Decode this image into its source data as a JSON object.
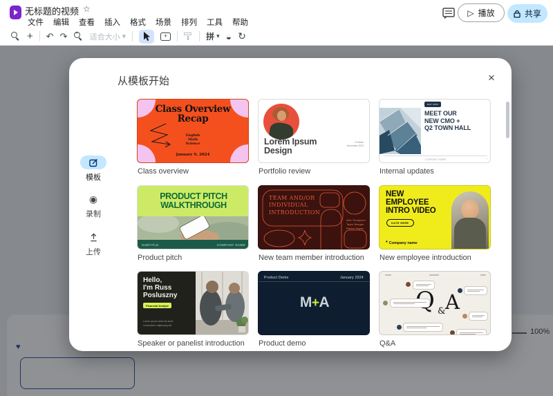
{
  "header": {
    "title": "无标题的视频",
    "menu": [
      "文件",
      "编辑",
      "查看",
      "插入",
      "格式",
      "场景",
      "排列",
      "工具",
      "帮助"
    ],
    "play": "播放",
    "share": "共享"
  },
  "toolbar": {
    "fit": "适合大小",
    "pin": "拼"
  },
  "icons": {
    "star": "☆",
    "caret": "▾",
    "undo": "↶",
    "redo": "↷",
    "plus": "+",
    "play_outline": "▷",
    "record": "◉",
    "theme": "◒",
    "transition": "↻",
    "close": "×",
    "heart": "♥",
    "asterisk": "*",
    "chevron_right": "›"
  },
  "modal": {
    "title": "从模板开始",
    "sidebar": [
      {
        "label": "模板",
        "active": true
      },
      {
        "label": "录制",
        "active": false
      },
      {
        "label": "上传",
        "active": false
      }
    ],
    "templates": [
      {
        "caption": "Class overview",
        "title": "Class Overview\nRecap",
        "subjects": "English\nMath\nScience",
        "date": "January 9, 2024"
      },
      {
        "caption": "Portfolio review",
        "title": "Lorem Ipsum\nDesign",
        "meta": "Portfolio\nNovember 2023"
      },
      {
        "caption": "Internal updates",
        "badge": "MAY 2023",
        "title": "MEET OUR\nNEW CMO +\nQ2 TOWN HALL",
        "footer": "COMPANY NAME"
      },
      {
        "caption": "Product pitch",
        "title": "PRODUCT PITCH\nWALKTHROUGH",
        "subtitle": "SUBTITLE",
        "company": "COMPANY NAME"
      },
      {
        "caption": "New team member introduction",
        "title": "TEAM AND/OR\nINDIVIDUAL\nINTRODUCTION",
        "names": "Alex Thompson\nTaylor Morgan\nRachel Hayes"
      },
      {
        "caption": "New employee introduction",
        "title": "NEW\nEMPLOYEE\nINTRO VIDEO",
        "badge": "DATE HERE",
        "company": "Company name"
      },
      {
        "caption": "Speaker or panelist introduction",
        "title": "Hello,\nI'm Russ\nPosluszny",
        "role": "Financial Analyst",
        "blurb": "Lorem ipsum dolor sit amet,\nconsectetur adipiscing elit."
      },
      {
        "caption": "Product demo",
        "header_left": "Product Demo",
        "header_right": "January 2024",
        "m": "M",
        "plus": "+",
        "a": "A"
      },
      {
        "caption": "Q&A",
        "q": "Q",
        "amp": "&",
        "a": "A"
      }
    ]
  },
  "editor": {
    "zoom": "100%"
  },
  "colors": {
    "brand_purple": "#7c25cb",
    "share_blue": "#c2e7ff",
    "active_pill_blue": "#c2e7ff",
    "card1_orange": "#f4501e",
    "card4_maroon": "#3c120f",
    "card5_yellow": "#f0ec1c",
    "card7_navy": "#0f1d30"
  }
}
